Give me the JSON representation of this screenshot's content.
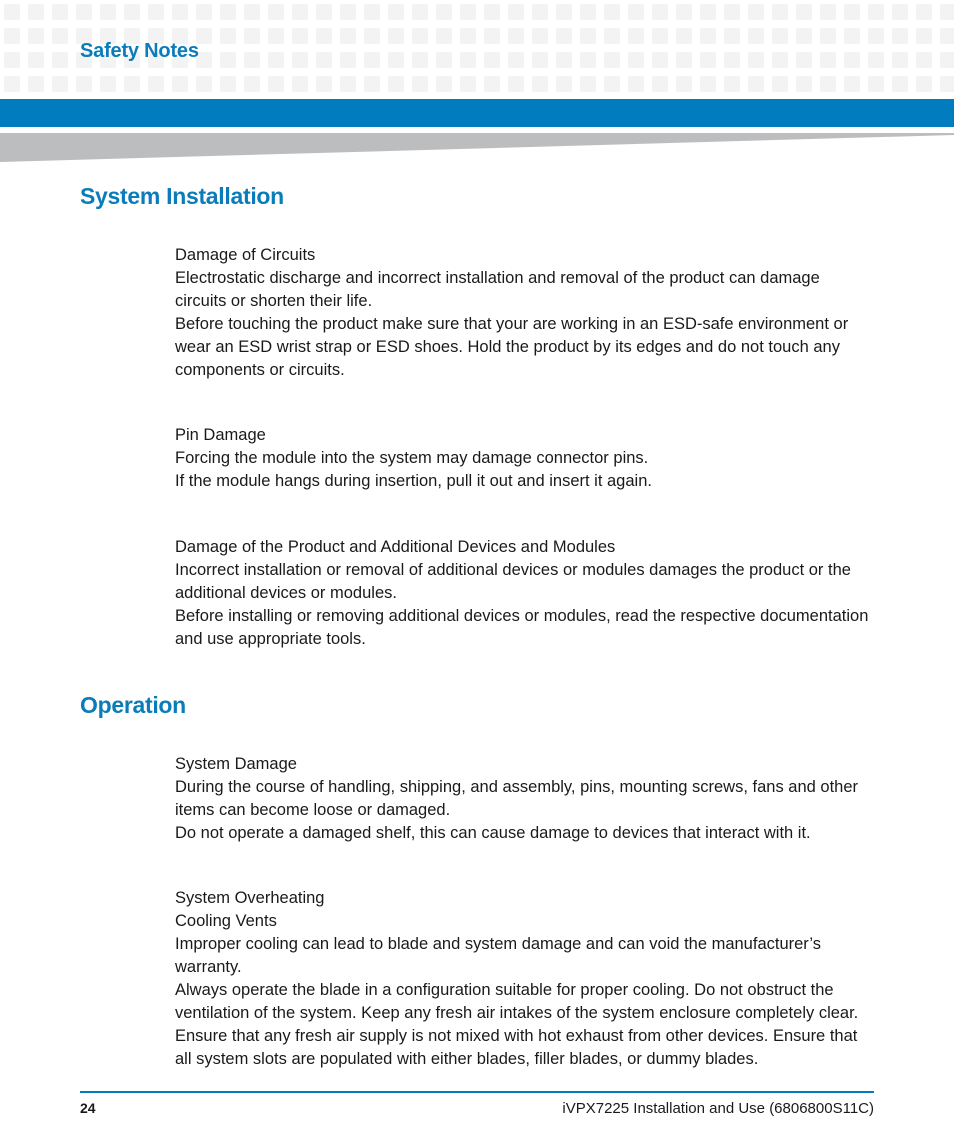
{
  "header": {
    "chapter_title": "Safety Notes",
    "colors": {
      "accent_blue": "#007cbf",
      "heading_blue": "#0b7cba",
      "wedge_gray": "#bcbdbf",
      "grid_gray": "#f3f3f3"
    }
  },
  "sections": [
    {
      "heading": "System Installation",
      "notices": [
        {
          "title": "Damage of Circuits",
          "lines": [
            "Electrostatic discharge and incorrect installation and removal of the product can damage circuits or shorten their life.",
            "Before touching the product make sure that your are working in an ESD-safe environment or wear an ESD wrist strap or ESD shoes. Hold the product by its edges and do not touch any components or circuits."
          ]
        },
        {
          "title": "Pin Damage",
          "lines": [
            "Forcing the module into the system may damage connector pins.",
            "If the module hangs during insertion, pull it out and insert it again."
          ]
        },
        {
          "title": "Damage of the Product and Additional Devices and Modules",
          "lines": [
            "Incorrect installation or removal of additional devices or modules damages the product or the additional devices or modules.",
            "Before installing or removing additional devices or modules, read the respective documentation and use appropriate tools."
          ]
        }
      ]
    },
    {
      "heading": "Operation",
      "notices": [
        {
          "title": "System Damage",
          "lines": [
            "During the course of handling, shipping, and assembly, pins, mounting screws, fans and other items can become loose or damaged.",
            "Do not operate a damaged shelf, this can cause damage to devices that interact with it."
          ]
        },
        {
          "title": "System Overheating",
          "subtitle": "Cooling Vents",
          "lines": [
            "Improper cooling can lead to blade and system damage and can void the manufacturer’s warranty.",
            "Always operate the blade in a configuration suitable for proper cooling. Do not obstruct the ventilation of the system. Keep any fresh air intakes of the system enclosure completely clear. Ensure that any fresh air supply is not mixed with hot exhaust from other devices. Ensure that all system slots are populated with either blades, filler blades, or dummy blades."
          ]
        }
      ]
    }
  ],
  "footer": {
    "page_number": "24",
    "document_title": "iVPX7225 Installation and Use (6806800S11C)"
  }
}
